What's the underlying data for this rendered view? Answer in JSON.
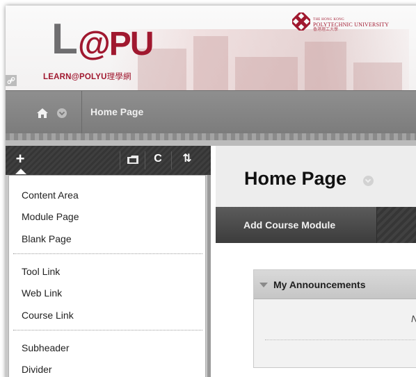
{
  "banner": {
    "logo_l": "L",
    "logo_rest": "@PU",
    "logo_tagline": "LEARN@POLYU",
    "logo_tagline_cjk": "理學網",
    "university_small": "THE HONG KONG",
    "university_name": "POLYTECHNIC UNIVERSITY",
    "university_cn": "香港理工大學"
  },
  "breadcrumb": {
    "current": "Home Page"
  },
  "left_toolbar": {
    "add_icon": "plus-icon",
    "folder_icon": "folder-icon",
    "refresh_icon": "refresh-icon",
    "reorder_icon": "reorder-icon",
    "add_label": "+",
    "refresh_label": "C",
    "reorder_label": "⇅"
  },
  "add_menu": {
    "group1": [
      "Content Area",
      "Module Page",
      "Blank Page"
    ],
    "group2": [
      "Tool Link",
      "Web Link",
      "Course Link"
    ],
    "group3": [
      "Subheader",
      "Divider"
    ]
  },
  "main": {
    "page_title": "Home Page",
    "action_button": "Add Course Module",
    "module_title": "My Announcements",
    "module_fragment": "N"
  },
  "colors": {
    "brand": "#a0182f",
    "grey_logo": "#6f6e70",
    "nav_bar": "#848484",
    "dark_toolbar": "#3a3a3a"
  }
}
